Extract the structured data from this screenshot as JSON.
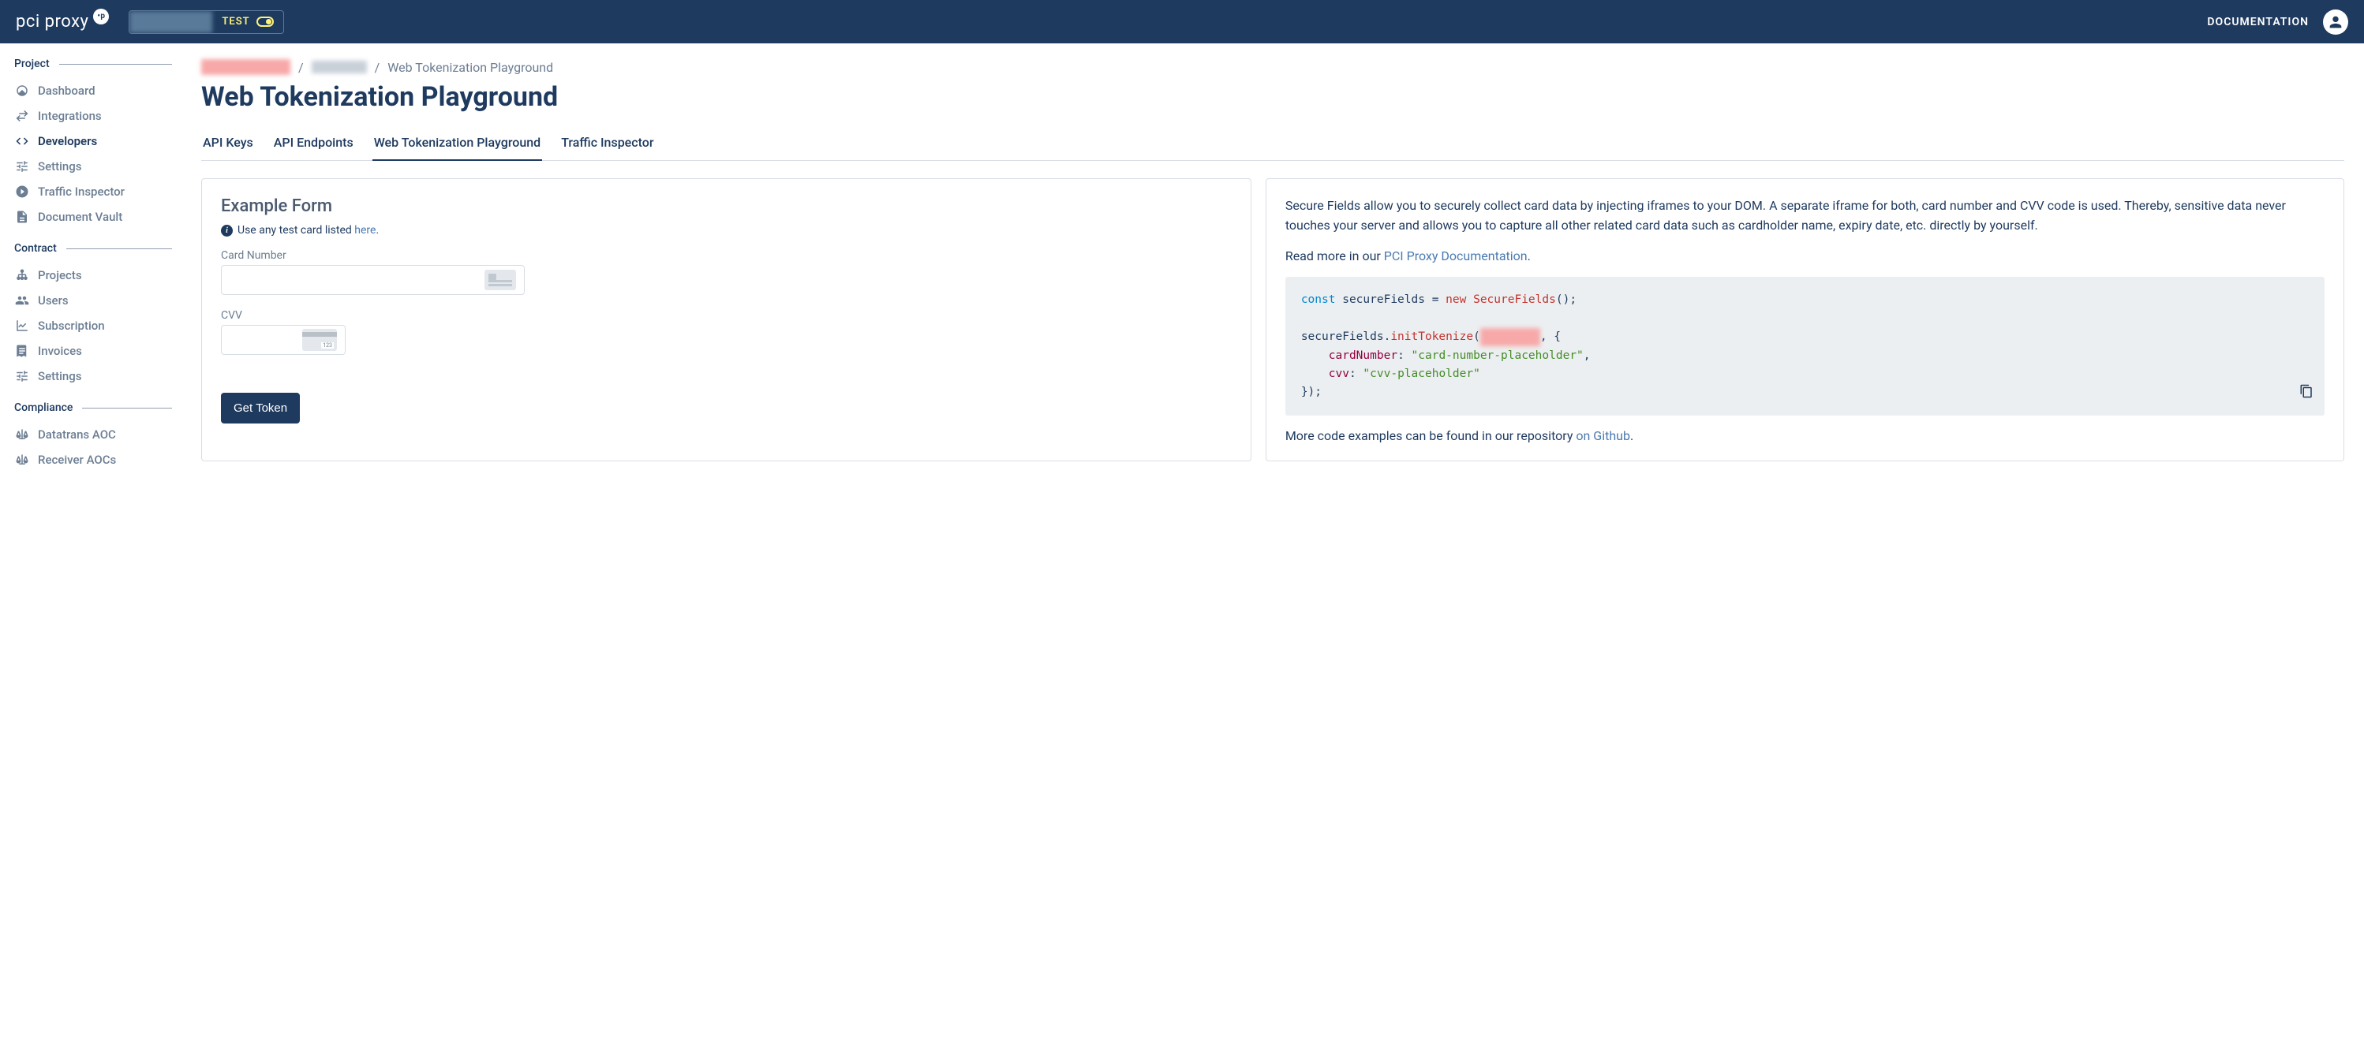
{
  "header": {
    "logo": "pci proxy",
    "env_label": "TEST",
    "documentation": "DOCUMENTATION"
  },
  "sidebar": {
    "sections": {
      "project": {
        "title": "Project",
        "items": [
          {
            "label": "Dashboard"
          },
          {
            "label": "Integrations"
          },
          {
            "label": "Developers"
          },
          {
            "label": "Settings"
          },
          {
            "label": "Traffic Inspector"
          },
          {
            "label": "Document Vault"
          }
        ]
      },
      "contract": {
        "title": "Contract",
        "items": [
          {
            "label": "Projects"
          },
          {
            "label": "Users"
          },
          {
            "label": "Subscription"
          },
          {
            "label": "Invoices"
          },
          {
            "label": "Settings"
          }
        ]
      },
      "compliance": {
        "title": "Compliance",
        "items": [
          {
            "label": "Datatrans AOC"
          },
          {
            "label": "Receiver AOCs"
          }
        ]
      }
    }
  },
  "breadcrumb": {
    "current": "Web Tokenization Playground"
  },
  "page_title": "Web Tokenization Playground",
  "tabs": [
    {
      "label": "API Keys"
    },
    {
      "label": "API Endpoints"
    },
    {
      "label": "Web Tokenization Playground"
    },
    {
      "label": "Traffic Inspector"
    }
  ],
  "form": {
    "title": "Example Form",
    "help_text": "Use any test card listed ",
    "help_link": "here",
    "card_label": "Card Number",
    "cvv_label": "CVV",
    "submit": "Get Token"
  },
  "info": {
    "desc_1": "Secure Fields allow you to securely collect card data by injecting iframes to your DOM. A separate iframe for both, card number and CVV code is used. Thereby, sensitive data never touches your server and allows you to capture all other related card data such as cardholder name, expiry date, etc. directly by yourself.",
    "desc_2_pre": "Read more in our ",
    "desc_2_link": "PCI Proxy Documentation",
    "desc_2_post": ".",
    "code": {
      "line1_kw": "const",
      "line1_var": " secureFields ",
      "line1_eq": "=",
      "line1_new": " new ",
      "line1_class": "SecureFields",
      "line1_paren": "();",
      "line3_obj": "secureFields.",
      "line3_method": "initTokenize",
      "line3_open": "(",
      "line3_tail": ", {",
      "line4_indent": "    ",
      "line4_prop": "cardNumber",
      "line4_colon": ": ",
      "line4_str": "\"card-number-placeholder\"",
      "line4_comma": ",",
      "line5_prop": "cvv",
      "line5_colon": ": ",
      "line5_str": "\"cvv-placeholder\"",
      "line6": "});"
    },
    "footer_pre": "More code examples can be found in our repository ",
    "footer_link": "on Github",
    "footer_post": "."
  }
}
